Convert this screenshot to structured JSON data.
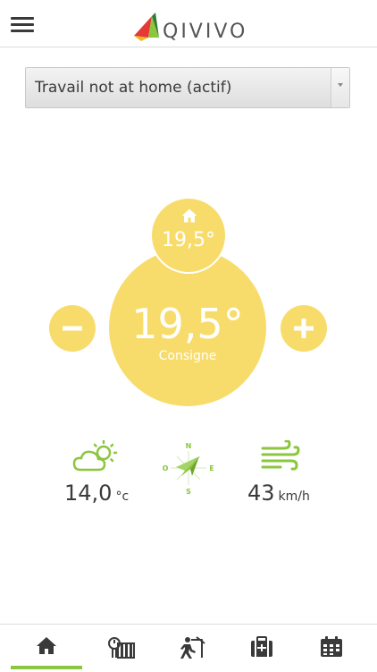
{
  "header": {
    "brand": "QIVIVO"
  },
  "mode_select": {
    "selected": "Travail not at home (actif)"
  },
  "thermostat": {
    "presence_temp": "19,5°",
    "setpoint_temp": "19,5°",
    "setpoint_label": "Consigne"
  },
  "weather": {
    "temperature": "14,0",
    "temperature_unit": "°c",
    "compass": {
      "north": "N",
      "east": "E",
      "south": "S",
      "west": "O"
    },
    "wind_speed": "43",
    "wind_unit": "km/h"
  },
  "nav": {
    "active": "home"
  },
  "colors": {
    "accent_yellow": "#f8dc6b",
    "accent_green": "#8cc63e",
    "text_dark": "#3a3a3a"
  }
}
